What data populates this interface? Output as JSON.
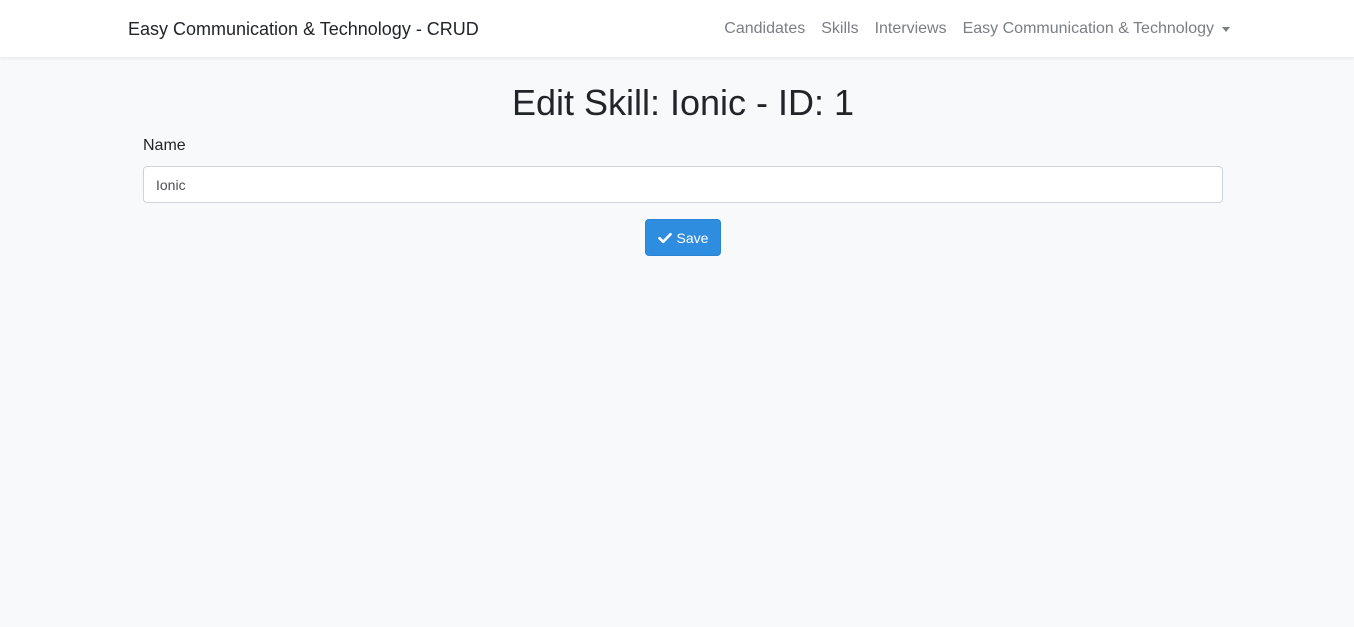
{
  "navbar": {
    "brand": "Easy Communication & Technology - CRUD",
    "links": [
      {
        "label": "Candidates"
      },
      {
        "label": "Skills"
      },
      {
        "label": "Interviews"
      },
      {
        "label": "Easy Communication & Technology"
      }
    ]
  },
  "main": {
    "title": "Edit Skill: Ionic - ID: 1",
    "form": {
      "name_label": "Name",
      "name_value": "Ionic"
    },
    "save_label": "Save",
    "save_icon": "check-icon",
    "accent_color": "#2f8de0"
  }
}
